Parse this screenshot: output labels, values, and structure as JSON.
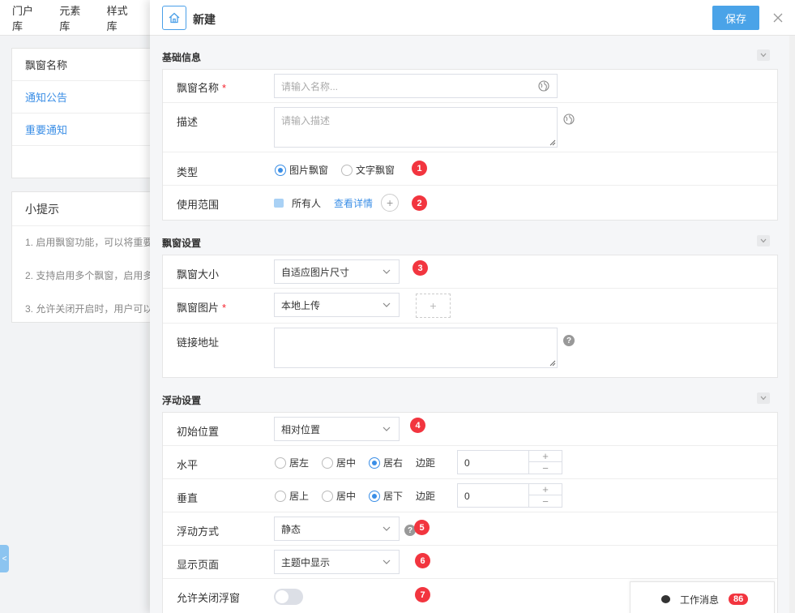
{
  "background": {
    "nav_tabs": [
      "门户库",
      "元素库",
      "样式库"
    ],
    "table": {
      "header": "飘窗名称",
      "rows": [
        "通知公告",
        "重要通知"
      ]
    },
    "tips": {
      "title": "小提示",
      "items": [
        "1. 启用飘窗功能，可以将重要",
        "2. 支持启用多个飘窗，启用多",
        "3. 允许关闭开启时，用户可以"
      ]
    },
    "side_handle": "<"
  },
  "drawer": {
    "title": "新建",
    "save_label": "保存",
    "close_symbol": "✕",
    "basic": {
      "section_title": "基础信息",
      "name_label": "飘窗名称",
      "required_mark": "*",
      "name_placeholder": "请输入名称...",
      "desc_label": "描述",
      "desc_placeholder": "请输入描述",
      "type_label": "类型",
      "type_options": [
        "图片飘窗",
        "文字飘窗"
      ],
      "type_selected": "图片飘窗",
      "type_badge": "1",
      "scope_label": "使用范围",
      "scope_value": "所有人",
      "scope_link": "查看详情",
      "scope_add": "+",
      "scope_badge": "2"
    },
    "window": {
      "section_title": "飘窗设置",
      "size_label": "飘窗大小",
      "size_value": "自适应图片尺寸",
      "size_badge": "3",
      "image_label": "飘窗图片",
      "image_source": "本地上传",
      "upload_symbol": "+",
      "link_label": "链接地址",
      "help_symbol": "?"
    },
    "float": {
      "section_title": "浮动设置",
      "init_label": "初始位置",
      "init_value": "相对位置",
      "init_badge": "4",
      "horizontal_label": "水平",
      "horizontal_options": [
        "居左",
        "居中",
        "居右"
      ],
      "horizontal_selected": "居右",
      "margin_label": "边距",
      "horizontal_margin": "0",
      "vertical_label": "垂直",
      "vertical_options": [
        "居上",
        "居中",
        "居下"
      ],
      "vertical_selected": "居下",
      "vertical_margin": "0",
      "mode_label": "浮动方式",
      "mode_value": "静态",
      "mode_badge": "5",
      "page_label": "显示页面",
      "page_value": "主题中显示",
      "page_badge": "6",
      "close_label": "允许关闭浮窗",
      "close_enabled": false,
      "close_badge": "7"
    }
  },
  "messages": {
    "label": "工作消息",
    "count": "86"
  },
  "colors": {
    "accent": "#3a8ee6",
    "save_button": "#4aa3e8",
    "badge": "#f2353f",
    "required": "#f5222d"
  },
  "icons": [
    "home-icon",
    "close-icon",
    "chevron-down-icon",
    "globe-icon",
    "help-icon",
    "user-group-icon",
    "chat-icon"
  ]
}
